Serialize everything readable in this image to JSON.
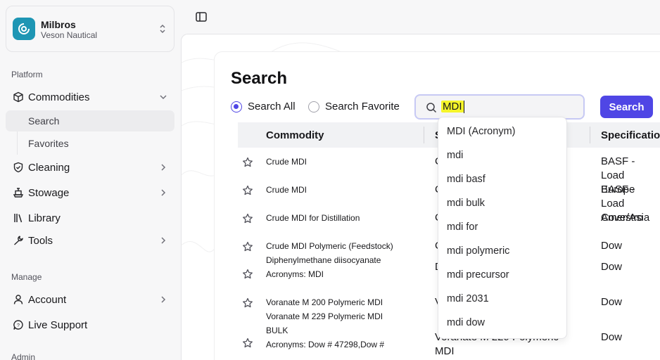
{
  "org": {
    "name": "Milbros",
    "subtitle": "Veson Nautical"
  },
  "sidebar": {
    "platform_label": "Platform",
    "manage_label": "Manage",
    "admin_label": "Admin",
    "items": {
      "commodities": "Commodities",
      "search": "Search",
      "favorites": "Favorites",
      "cleaning": "Cleaning",
      "stowage": "Stowage",
      "library": "Library",
      "tools": "Tools",
      "account": "Account",
      "live_support": "Live Support"
    }
  },
  "page": {
    "title": "Search"
  },
  "search": {
    "radio_all": "Search All",
    "radio_favorite": "Search Favorite",
    "selected_radio": "Search All",
    "query": "MDI",
    "button": "Search"
  },
  "table": {
    "headers": {
      "commodity": "Commodity",
      "col2": "S",
      "specification": "Specification"
    },
    "rows": [
      {
        "commodity": [
          "Crude MDI"
        ],
        "col2": "C",
        "spec": [
          "BASF - Load",
          "Europe"
        ]
      },
      {
        "commodity": [
          "Crude MDI"
        ],
        "col2": "C",
        "spec": [
          "BASF - Load",
          "Amer/Asia"
        ]
      },
      {
        "commodity": [
          "Crude MDI for Distillation"
        ],
        "col2": "C",
        "spec": [
          "Covestro"
        ]
      },
      {
        "commodity": [
          "Crude MDI Polymeric (Feedstock)"
        ],
        "col2": "C",
        "spec": [
          "Dow"
        ]
      },
      {
        "commodity": [
          "Diphenylmethane diisocyanate",
          "Acronyms: MDI"
        ],
        "col2": "D                                   ate",
        "spec": [
          "Dow"
        ]
      },
      {
        "commodity": [
          "Voranate M 200 Polymeric MDI"
        ],
        "col2": "V",
        "spec": [
          "Dow"
        ]
      },
      {
        "commodity": [
          "Voranate M 229 Polymeric MDI",
          "BULK",
          "Acronyms: Dow # 47298,Dow #"
        ],
        "col2_lines": [
          "Voranate M 229 Polymeric",
          "MDI"
        ],
        "spec": [
          "Dow"
        ]
      }
    ]
  },
  "suggestions": [
    "MDI (Acronym)",
    "mdi",
    "mdi basf",
    "mdi bulk",
    "mdi for",
    "mdi polymeric",
    "mdi precursor",
    "mdi 2031",
    "mdi dow"
  ],
  "colors": {
    "accent": "#4f46e5",
    "highlight": "#f5f52a",
    "logo": "#1e96b4"
  }
}
